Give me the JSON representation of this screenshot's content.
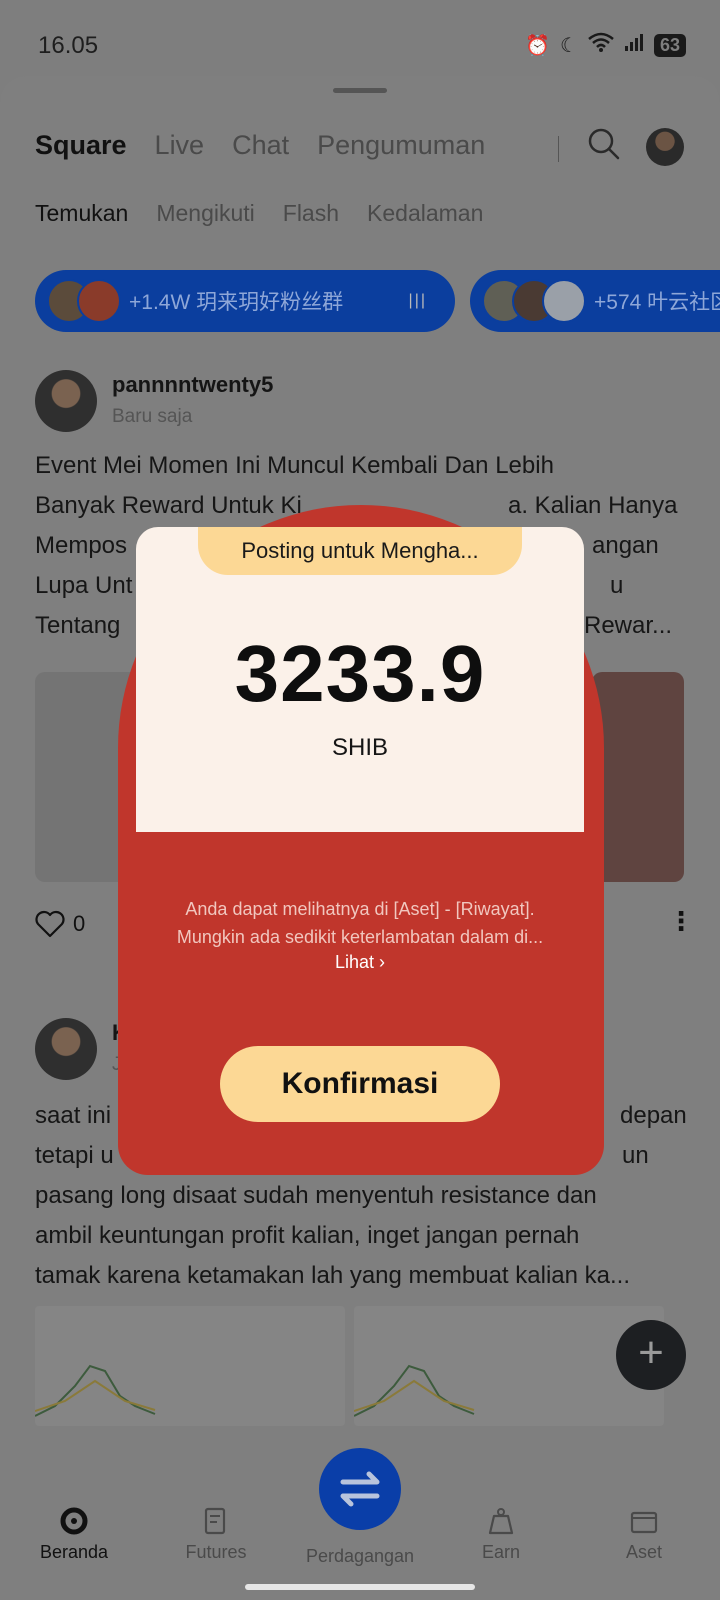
{
  "status_bar": {
    "time": "16.05",
    "battery": "63"
  },
  "top_tabs": [
    "Square",
    "Live",
    "Chat",
    "Pengumuman"
  ],
  "sub_tabs": [
    "Temukan",
    "Mengikuti",
    "Flash",
    "Kedalaman"
  ],
  "groups": [
    {
      "label": "+1.4W 玥来玥好粉丝群"
    },
    {
      "label": "+574 叶云社区–"
    }
  ],
  "posts": [
    {
      "author": "pannnntwenty5",
      "time": "Baru saja",
      "text_lines": [
        "Event Mei Momen Ini Muncul Kembali Dan Lebih",
        "Banyak Reward Untuk Ki",
        "Mempos",
        "Lupa Unt",
        "Tentang"
      ],
      "text_right_fragments": [
        "a. Kalian Hanya Perlu",
        "angan",
        "u",
        "Rewar..."
      ],
      "likes": "0"
    },
    {
      "author_fragment": "K",
      "time_fragment": "J",
      "text_lines": [
        "saat ini",
        "tetapi u",
        "pasang long disaat sudah menyentuh resistance dan",
        "ambil keuntungan profit kalian, inget jangan pernah",
        "tamak karena ketamakan lah yang membuat kalian ka..."
      ],
      "text_right_fragments": [
        "depan",
        "un"
      ]
    }
  ],
  "modal": {
    "ribbon": "Posting untuk Mengha...",
    "amount": "3233.9",
    "unit": "SHIB",
    "info_line1": "Anda dapat melihatnya di [Aset] - [Riwayat].",
    "info_line2": "Mungkin ada sedikit keterlambatan dalam di...",
    "link": "Lihat",
    "confirm": "Konfirmasi"
  },
  "bottom_nav": [
    "Beranda",
    "Futures",
    "Perdagangan",
    "Earn",
    "Aset"
  ],
  "colors": {
    "modal_red": "#c0362c",
    "card_cream": "#fbf1e9",
    "accent_yellow": "#fcd895",
    "brand_blue": "#0b3e9e"
  }
}
